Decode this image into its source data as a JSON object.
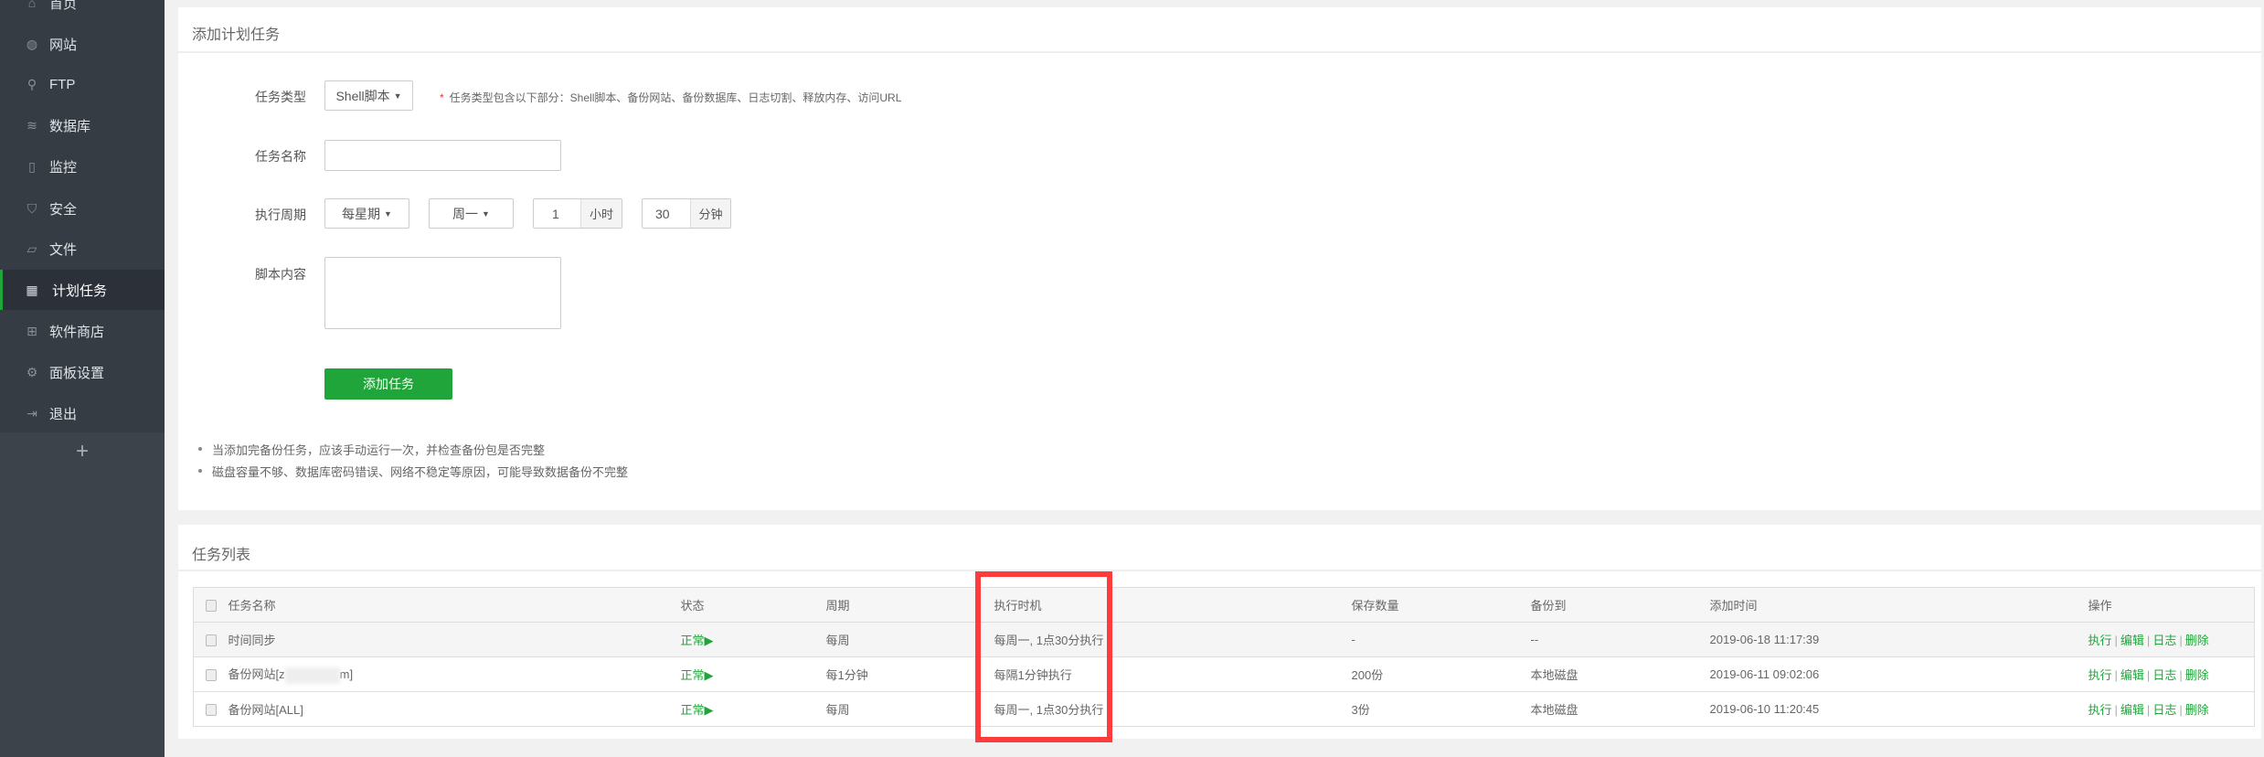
{
  "sidebar": {
    "items": [
      {
        "label": "首页",
        "icon": "home-icon"
      },
      {
        "label": "网站",
        "icon": "globe-icon"
      },
      {
        "label": "FTP",
        "icon": "ftp-icon"
      },
      {
        "label": "数据库",
        "icon": "database-icon"
      },
      {
        "label": "监控",
        "icon": "monitor-icon"
      },
      {
        "label": "安全",
        "icon": "shield-icon"
      },
      {
        "label": "文件",
        "icon": "folder-icon"
      },
      {
        "label": "计划任务",
        "icon": "calendar-icon",
        "active": true
      },
      {
        "label": "软件商店",
        "icon": "apps-icon"
      },
      {
        "label": "面板设置",
        "icon": "gear-icon"
      },
      {
        "label": "退出",
        "icon": "logout-icon"
      }
    ],
    "add": "+"
  },
  "form": {
    "title": "添加计划任务",
    "type_label": "任务类型",
    "type_value": "Shell脚本",
    "hint_star": "*",
    "hint": "任务类型包含以下部分：Shell脚本、备份网站、备份数据库、日志切割、释放内存、访问URL",
    "name_label": "任务名称",
    "name_value": "",
    "period_label": "执行周期",
    "period_value": "每星期",
    "weekday_value": "周一",
    "hour_value": "1",
    "hour_unit": "小时",
    "minute_value": "30",
    "minute_unit": "分钟",
    "script_label": "脚本内容",
    "script_value": "",
    "submit": "添加任务",
    "notes": [
      "当添加完备份任务，应该手动运行一次，并检查备份包是否完整",
      "磁盘容量不够、数据库密码错误、网络不稳定等原因，可能导致数据备份不完整"
    ]
  },
  "list": {
    "title": "任务列表",
    "columns": [
      "任务名称",
      "状态",
      "周期",
      "执行时机",
      "保存数量",
      "备份到",
      "添加时间",
      "操作"
    ],
    "rows": [
      {
        "name": "时间同步",
        "status": "正常",
        "period": "每周",
        "timing": "每周一, 1点30分执行",
        "keep": "-",
        "backup_to": "--",
        "added": "2019-06-18 11:17:39"
      },
      {
        "name_prefix": "备份网站[z",
        "name_suffix": "m]",
        "status": "正常",
        "period": "每1分钟",
        "timing": "每隔1分钟执行",
        "keep": "200份",
        "backup_to": "本地磁盘",
        "added": "2019-06-11 09:02:06"
      },
      {
        "name": "备份网站[ALL]",
        "status": "正常",
        "period": "每周",
        "timing": "每周一, 1点30分执行",
        "keep": "3份",
        "backup_to": "本地磁盘",
        "added": "2019-06-10 11:20:45"
      }
    ],
    "actions": [
      "执行",
      "编辑",
      "日志",
      "删除"
    ],
    "status_arrow": "▶"
  },
  "colors": {
    "accent": "#20a53a",
    "highlight": "#ff3b3b",
    "sidebar": "#353c44"
  }
}
